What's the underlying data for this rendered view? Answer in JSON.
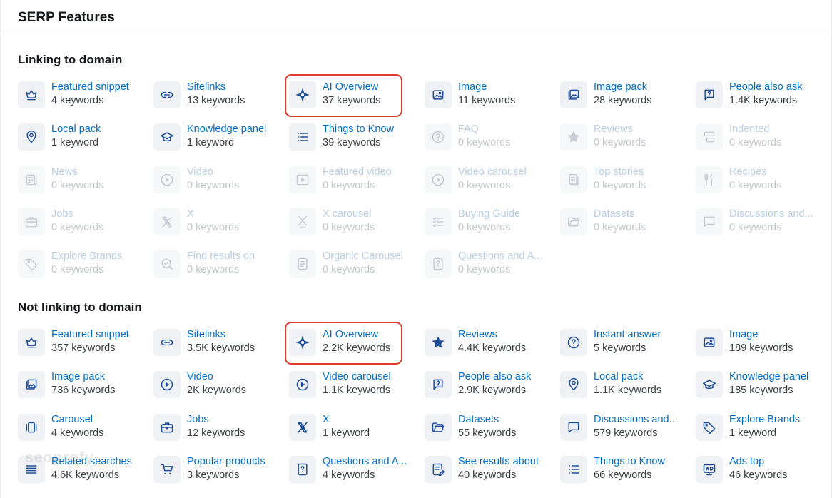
{
  "header": {
    "title": "SERP Features"
  },
  "sections": [
    {
      "title": "Linking to domain",
      "items": [
        {
          "name": "Featured snippet",
          "count": "4 keywords",
          "icon": "crown-icon",
          "active": true
        },
        {
          "name": "Sitelinks",
          "count": "13 keywords",
          "icon": "link-icon",
          "active": true
        },
        {
          "name": "AI Overview",
          "count": "37 keywords",
          "icon": "sparkle-icon",
          "active": true,
          "highlight": true
        },
        {
          "name": "Image",
          "count": "11 keywords",
          "icon": "image-icon",
          "active": true
        },
        {
          "name": "Image pack",
          "count": "28 keywords",
          "icon": "image-pack-icon",
          "active": true
        },
        {
          "name": "People also ask",
          "count": "1.4K keywords",
          "icon": "question-bubble-icon",
          "active": true
        },
        {
          "name": "Local pack",
          "count": "1 keyword",
          "icon": "location-pin-icon",
          "active": true
        },
        {
          "name": "Knowledge panel",
          "count": "1 keyword",
          "icon": "graduation-cap-icon",
          "active": true
        },
        {
          "name": "Things to Know",
          "count": "39 keywords",
          "icon": "list-icon",
          "active": true
        },
        {
          "name": "FAQ",
          "count": "0 keywords",
          "icon": "question-circle-icon",
          "active": false
        },
        {
          "name": "Reviews",
          "count": "0 keywords",
          "icon": "star-icon",
          "active": false
        },
        {
          "name": "Indented",
          "count": "0 keywords",
          "icon": "indented-icon",
          "active": false
        },
        {
          "name": "News",
          "count": "0 keywords",
          "icon": "news-icon",
          "active": false
        },
        {
          "name": "Video",
          "count": "0 keywords",
          "icon": "play-circle-icon",
          "active": false
        },
        {
          "name": "Featured video",
          "count": "0 keywords",
          "icon": "video-frame-icon",
          "active": false
        },
        {
          "name": "Video carousel",
          "count": "0 keywords",
          "icon": "play-circle-icon",
          "active": false
        },
        {
          "name": "Top stories",
          "count": "0 keywords",
          "icon": "stories-icon",
          "active": false
        },
        {
          "name": "Recipes",
          "count": "0 keywords",
          "icon": "fork-knife-icon",
          "active": false
        },
        {
          "name": "Jobs",
          "count": "0 keywords",
          "icon": "briefcase-icon",
          "active": false
        },
        {
          "name": "X",
          "count": "0 keywords",
          "icon": "x-logo-icon",
          "active": false
        },
        {
          "name": "X carousel",
          "count": "0 keywords",
          "icon": "x-carousel-icon",
          "active": false
        },
        {
          "name": "Buying Guide",
          "count": "0 keywords",
          "icon": "checklist-icon",
          "active": false
        },
        {
          "name": "Datasets",
          "count": "0 keywords",
          "icon": "folder-icon",
          "active": false
        },
        {
          "name": "Discussions and...",
          "count": "0 keywords",
          "icon": "chat-bubble-icon",
          "active": false
        },
        {
          "name": "Explore Brands",
          "count": "0 keywords",
          "icon": "tag-icon",
          "active": false
        },
        {
          "name": "Find results on",
          "count": "0 keywords",
          "icon": "search-check-icon",
          "active": false
        },
        {
          "name": "Organic Carousel",
          "count": "0 keywords",
          "icon": "document-icon",
          "active": false
        },
        {
          "name": "Questions and A...",
          "count": "0 keywords",
          "icon": "question-doc-icon",
          "active": false
        }
      ]
    },
    {
      "title": "Not linking to domain",
      "items": [
        {
          "name": "Featured snippet",
          "count": "357 keywords",
          "icon": "crown-icon",
          "active": true
        },
        {
          "name": "Sitelinks",
          "count": "3.5K keywords",
          "icon": "link-icon",
          "active": true
        },
        {
          "name": "AI Overview",
          "count": "2.2K keywords",
          "icon": "sparkle-icon",
          "active": true,
          "highlight": true
        },
        {
          "name": "Reviews",
          "count": "4.4K keywords",
          "icon": "star-icon",
          "active": true
        },
        {
          "name": "Instant answer",
          "count": "5 keywords",
          "icon": "question-circle-icon",
          "active": true
        },
        {
          "name": "Image",
          "count": "189 keywords",
          "icon": "image-icon",
          "active": true
        },
        {
          "name": "Image pack",
          "count": "736 keywords",
          "icon": "image-pack-icon",
          "active": true
        },
        {
          "name": "Video",
          "count": "2K keywords",
          "icon": "play-circle-icon",
          "active": true
        },
        {
          "name": "Video carousel",
          "count": "1.1K keywords",
          "icon": "play-circle-icon",
          "active": true
        },
        {
          "name": "People also ask",
          "count": "2.9K keywords",
          "icon": "question-bubble-icon",
          "active": true
        },
        {
          "name": "Local pack",
          "count": "1.1K keywords",
          "icon": "location-pin-icon",
          "active": true
        },
        {
          "name": "Knowledge panel",
          "count": "185 keywords",
          "icon": "graduation-cap-icon",
          "active": true
        },
        {
          "name": "Carousel",
          "count": "4 keywords",
          "icon": "carousel-icon",
          "active": true
        },
        {
          "name": "Jobs",
          "count": "12 keywords",
          "icon": "briefcase-icon",
          "active": true
        },
        {
          "name": "X",
          "count": "1 keyword",
          "icon": "x-logo-icon",
          "active": true
        },
        {
          "name": "Datasets",
          "count": "55 keywords",
          "icon": "folder-icon",
          "active": true
        },
        {
          "name": "Discussions and...",
          "count": "579 keywords",
          "icon": "chat-bubble-icon",
          "active": true
        },
        {
          "name": "Explore Brands",
          "count": "1 keyword",
          "icon": "tag-icon",
          "active": true
        },
        {
          "name": "Related searches",
          "count": "4.6K keywords",
          "icon": "related-list-icon",
          "active": true
        },
        {
          "name": "Popular products",
          "count": "3 keywords",
          "icon": "cart-icon",
          "active": true
        },
        {
          "name": "Questions and A...",
          "count": "4 keywords",
          "icon": "question-doc-icon",
          "active": true
        },
        {
          "name": "See results about",
          "count": "40 keywords",
          "icon": "document-pen-icon",
          "active": true
        },
        {
          "name": "Things to Know",
          "count": "66 keywords",
          "icon": "list-icon",
          "active": true
        },
        {
          "name": "Ads top",
          "count": "46 keywords",
          "icon": "ads-icon",
          "active": true
        }
      ]
    }
  ]
}
